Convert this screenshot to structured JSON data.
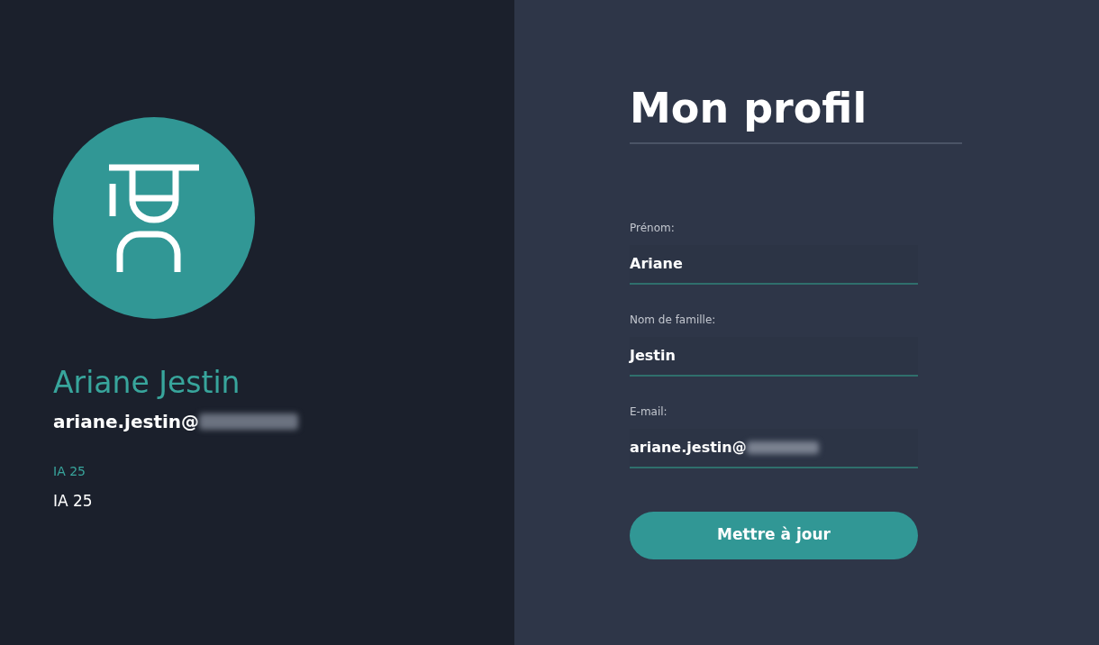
{
  "profile": {
    "name": "Ariane Jestin",
    "email": {
      "text": "ariane.jestin@",
      "redacted": true
    },
    "group_label": "IA 25",
    "group_value": "IA 25"
  },
  "form": {
    "title": "Mon profil",
    "fields": [
      {
        "label": "Prénom:",
        "value": "Ariane",
        "redacted": false
      },
      {
        "label": "Nom de famille:",
        "value": "Jestin",
        "redacted": false
      },
      {
        "label": "E-mail:",
        "value": "ariane.jestin@",
        "redacted": true
      }
    ],
    "button": "Mettre à jour"
  }
}
